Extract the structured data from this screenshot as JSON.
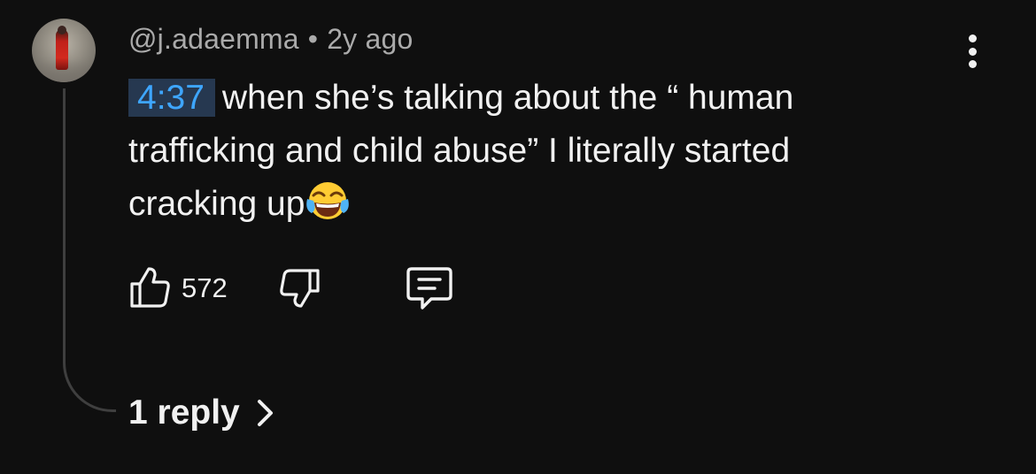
{
  "comment": {
    "author": "@j.adaemma",
    "separator": "•",
    "age": "2y ago",
    "timestamp": "4:37",
    "text_main": "when she’s talking about the “ human trafficking and child abuse” I literally started cracking up",
    "emoji": "face-with-tears-of-joy",
    "likes": "572",
    "replies_label": "1 reply"
  },
  "icons": {
    "like": "thumbs-up-icon",
    "dislike": "thumbs-down-icon",
    "reply": "comment-bubble-icon",
    "menu": "more-vertical-icon",
    "replies": "chevron-right-icon"
  },
  "colors": {
    "background": "#0f0f0f",
    "text": "#f1f1f1",
    "meta_text": "#aaaaaa",
    "timestamp_link": "#3ea6ff",
    "timestamp_bg": "#263850",
    "thread_line": "#3f3f3f"
  }
}
